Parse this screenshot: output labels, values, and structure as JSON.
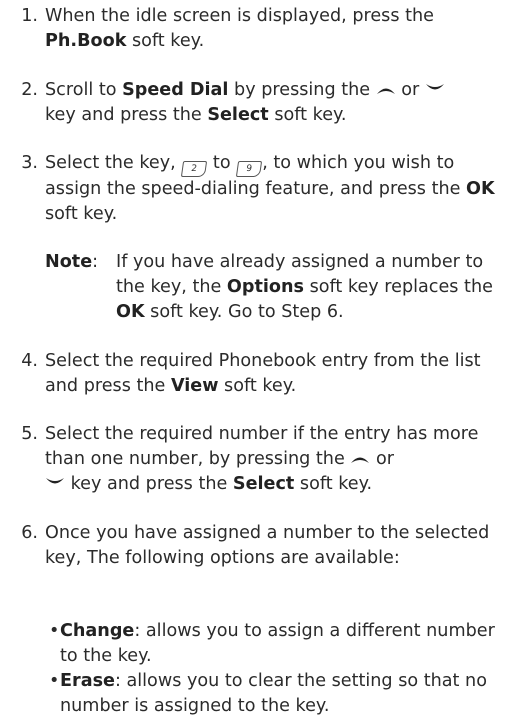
{
  "steps": [
    {
      "num": "1.",
      "p1": "When the idle screen is displayed, press the",
      "b1": "Ph.Book",
      "p2": " soft key."
    },
    {
      "num": "2.",
      "p1": "Scroll to ",
      "b1": "Speed Dial",
      "p2": " by pressing the",
      "p3": "or",
      "p4": "key and press the ",
      "b2": "Select",
      "p5": " soft key."
    },
    {
      "num": "3.",
      "p1": "Select the key,",
      "key1": "2",
      "p2": "to",
      "key2": "9",
      "p3": ", to which you wish to assign the speed-dialing feature, and press the ",
      "b1": "OK",
      "p4": " soft key."
    },
    {
      "num": "4.",
      "p1": "Select the required Phonebook entry from the list and press the ",
      "b1": "View",
      "p2": " soft key."
    },
    {
      "num": "5.",
      "p1": "Select the required number if the entry has more than one number, by pressing the",
      "p2": "or",
      "p3": "key and press the ",
      "b1": "Select",
      "p4": " soft key."
    },
    {
      "num": "6.",
      "p1": "Once you have assigned a number to the selected key, The following options are available:"
    }
  ],
  "note": {
    "label": "Note",
    "colon": ":",
    "p1": "If you have already assigned a number to the key, the ",
    "b1": "Options",
    "p2": " soft key replaces the ",
    "b2": "OK",
    "p3": " soft key. Go to Step 6."
  },
  "bullets": [
    {
      "dot": "•",
      "b": "Change",
      "text": ": allows you to assign a different number to the key."
    },
    {
      "dot": "•",
      "b": "Erase",
      "text": ": allows you to clear the setting so that no number is assigned to the key."
    }
  ]
}
